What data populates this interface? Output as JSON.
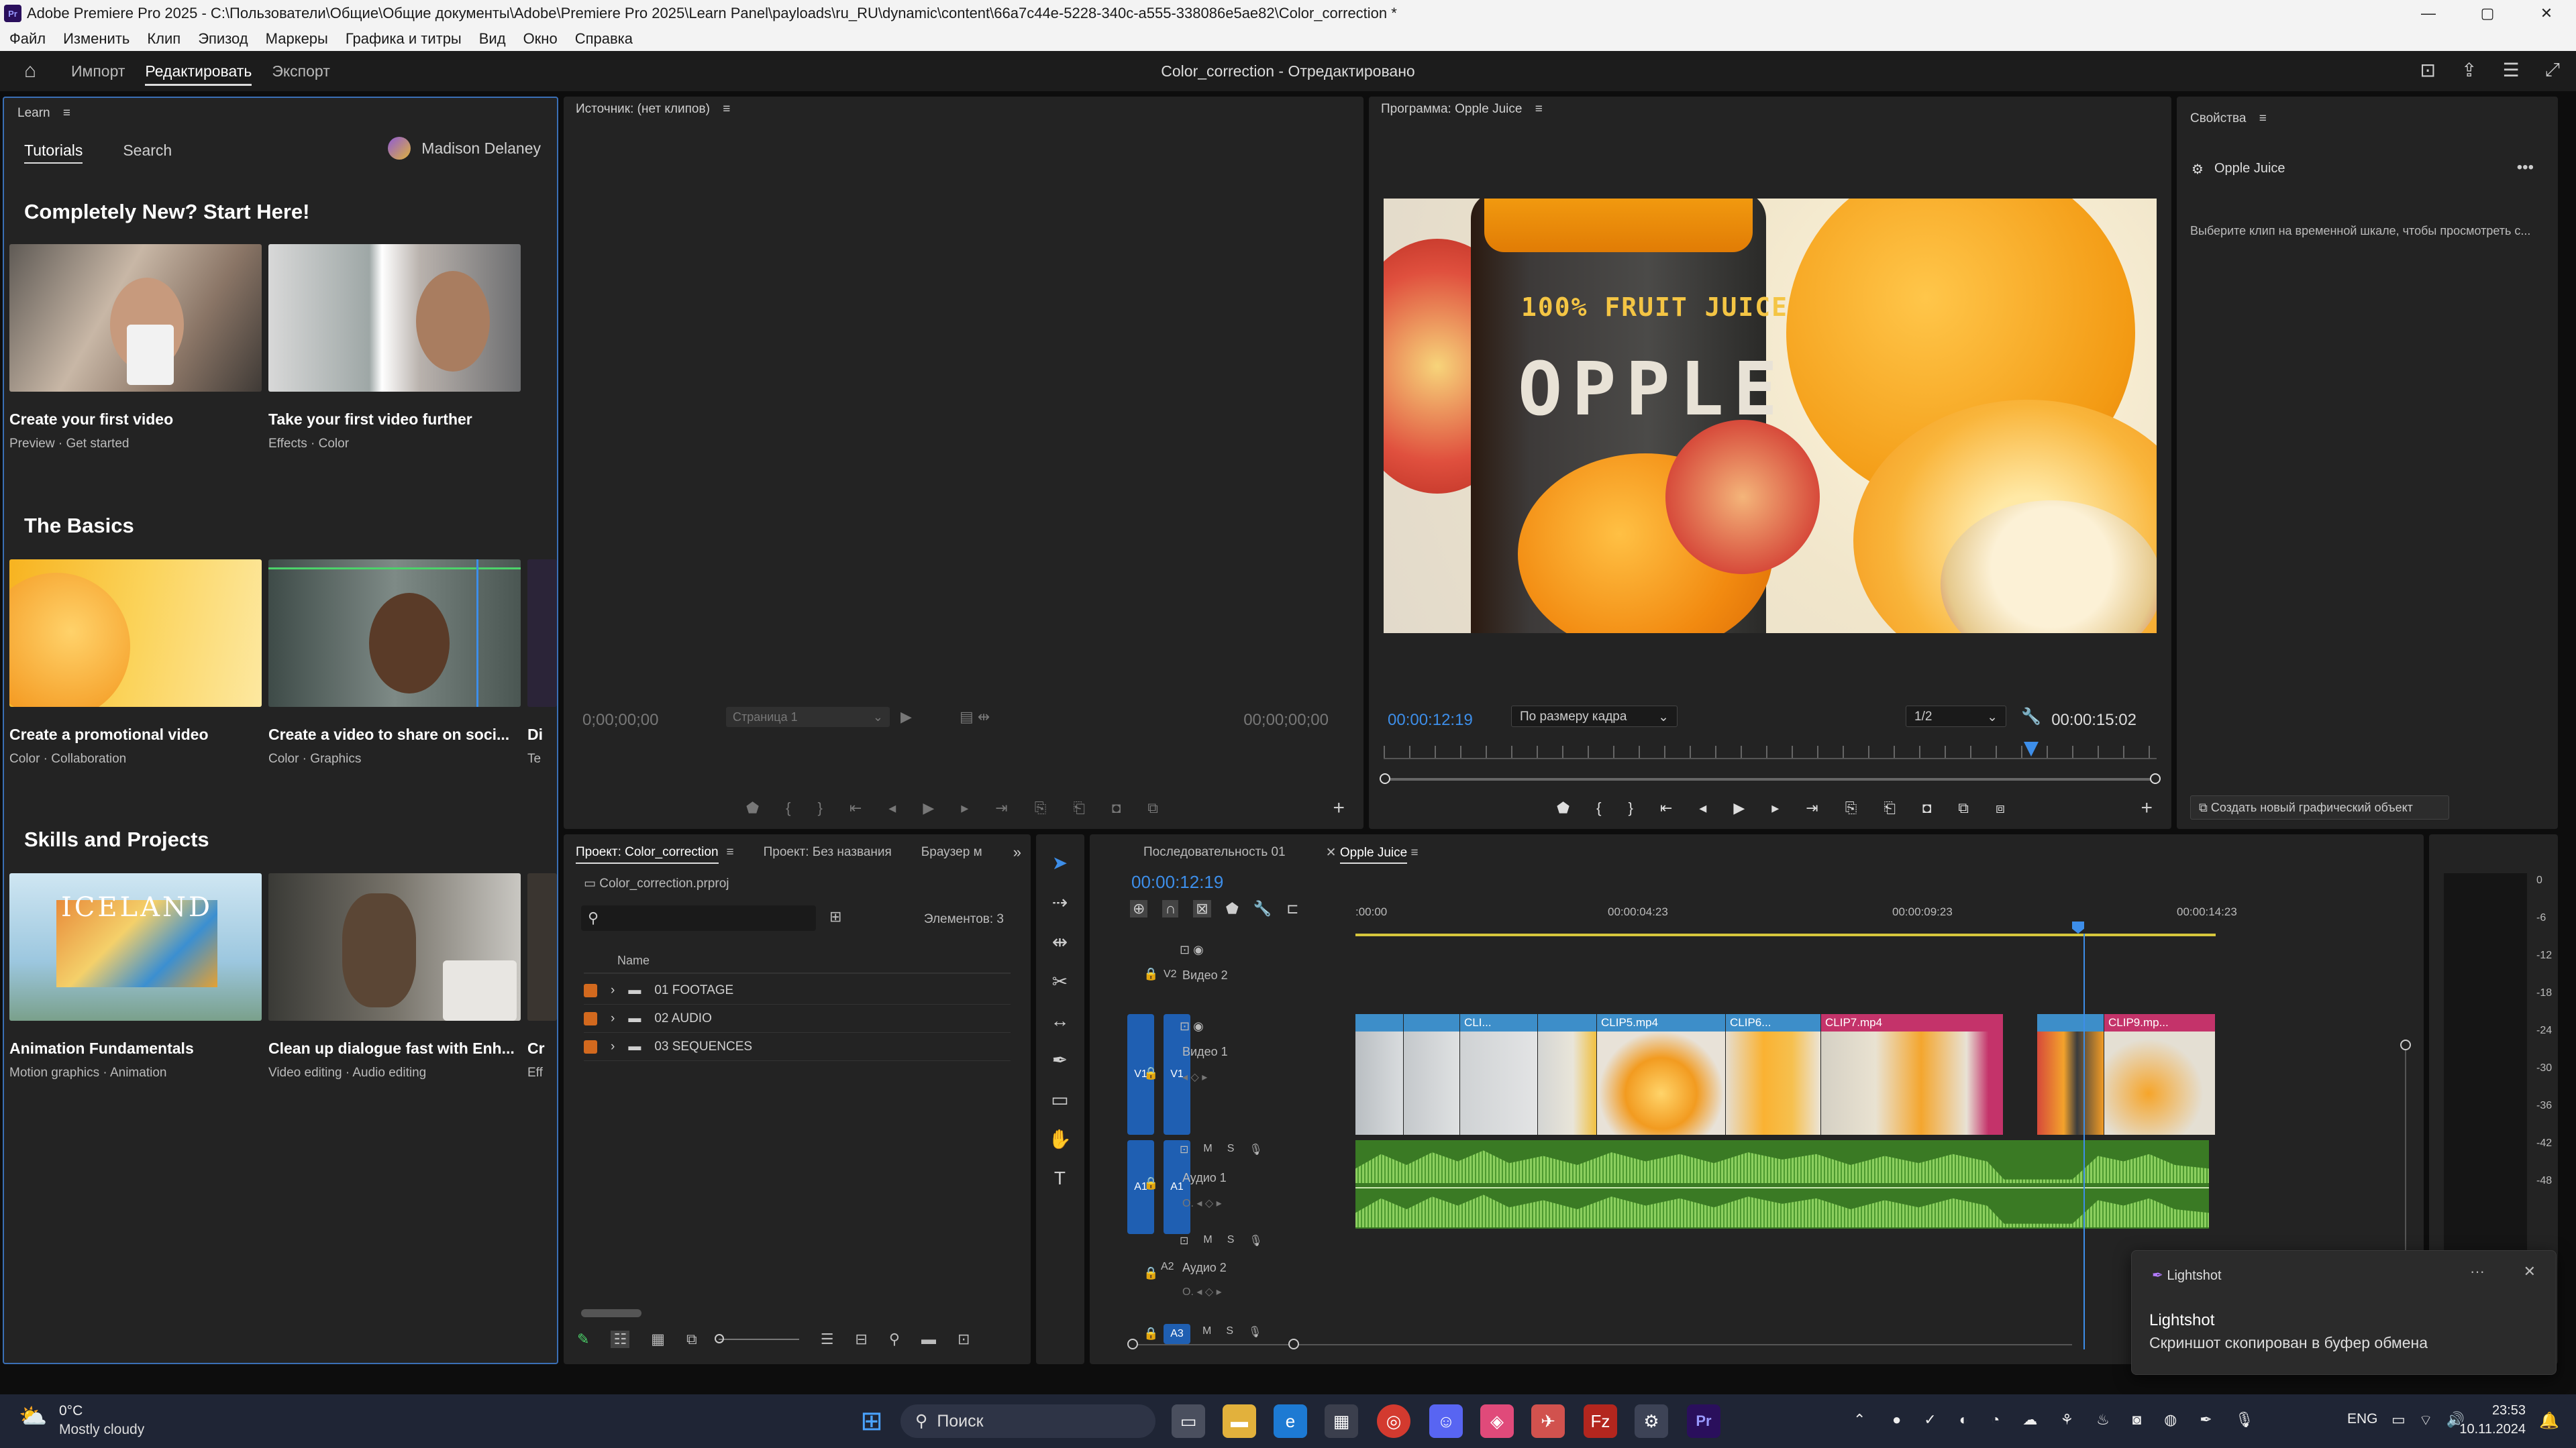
{
  "window": {
    "title": "Adobe Premiere Pro 2025 - C:\\Пользователи\\Общие\\Общие документы\\Adobe\\Premiere Pro 2025\\Learn Panel\\payloads\\ru_RU\\dynamic\\content\\66a7c44e-5228-340c-a555-338086e5ae82\\Color_correction *",
    "logo": "Pr",
    "minimize": "—",
    "maximize": "▢",
    "close": "✕"
  },
  "menu": [
    "Файл",
    "Изменить",
    "Клип",
    "Эпизод",
    "Маркеры",
    "Графика и титры",
    "Вид",
    "Окно",
    "Справка"
  ],
  "header": {
    "home_icon": "⌂",
    "tabs": [
      "Импорт",
      "Редактировать",
      "Экспорт"
    ],
    "doc_title": "Color_correction - Отредактировано"
  },
  "learn": {
    "title": "Learn",
    "tabs": [
      "Tutorials",
      "Search"
    ],
    "user": "Madison Delaney",
    "sections": [
      {
        "title": "Completely New? Start Here!",
        "cards": [
          {
            "title": "Create your first video",
            "sub": "Preview  ·  Get started"
          },
          {
            "title": "Take your first video further",
            "sub": "Effects  ·  Color"
          }
        ]
      },
      {
        "title": "The Basics",
        "cards": [
          {
            "title": "Create a promotional video",
            "sub": "Color  ·  Collaboration"
          },
          {
            "title": "Create a video to share on soci...",
            "sub": "Color  ·  Graphics"
          },
          {
            "title": "Di",
            "sub": "Te"
          }
        ]
      },
      {
        "title": "Skills and Projects",
        "cards": [
          {
            "title": "Animation Fundamentals",
            "sub": "Motion graphics  ·  Animation"
          },
          {
            "title": "Clean up dialogue fast with Enh...",
            "sub": "Video editing  ·  Audio editing"
          },
          {
            "title": "Cr",
            "sub": "Eff"
          }
        ]
      }
    ],
    "iceland": "ICELAND"
  },
  "source": {
    "title": "Источник: (нет клипов)",
    "tc_in": "0;00;00;00",
    "tc_out": "00;00;00;00",
    "page": "Страница 1"
  },
  "program": {
    "title": "Программа: Opple Juice",
    "timecode": "00:00:12:19",
    "fit": "По размеру кадра",
    "res": "1/2",
    "duration": "00:00:15:02",
    "label1": "100% FRUIT JUICE",
    "label2": "OPPLE"
  },
  "properties": {
    "title": "Свойства",
    "item": "Opple Juice",
    "hint": "Выберите клип на временной шкале, чтобы просмотреть с...",
    "button": "Создать новый графический объект"
  },
  "project": {
    "tabs": [
      "Проект: Color_correction",
      "Проект: Без названия",
      "Браузер м"
    ],
    "file": "Color_correction.prproj",
    "count": "Элементов: 3",
    "col_name": "Name",
    "items": [
      "01 FOOTAGE",
      "02 AUDIO",
      "03 SEQUENCES"
    ]
  },
  "timeline": {
    "tabs": [
      "Последовательность 01",
      "Opple Juice"
    ],
    "timecode": "00:00:12:19",
    "ruler": [
      ":00:00",
      "00:00:04:23",
      "00:00:09:23",
      "00:00:14:23"
    ],
    "tracks": {
      "v2": "V2",
      "v2name": "Видео 2",
      "v1": "V1",
      "v1name": "Видео 1",
      "a1": "A1",
      "a1name": "Аудио 1",
      "a2": "A2",
      "a2name": "Аудио 2",
      "a3": "A3"
    },
    "clips": [
      "",
      "",
      "CLI...",
      "",
      "CLIP5.mp4",
      "CLIP6...",
      "CLIP7.mp4",
      "",
      "CLIP9.mp..."
    ]
  },
  "meter": [
    "0",
    "-6",
    "-12",
    "-18",
    "-24",
    "-30",
    "-36",
    "-42",
    "-48"
  ],
  "notification": {
    "app": "Lightshot",
    "title": "Lightshot",
    "message": "Скриншот скопирован в буфер обмена"
  },
  "taskbar": {
    "temp": "0°C",
    "weather": "Mostly cloudy",
    "search": "Поиск",
    "lang": "ENG",
    "time": "23:53",
    "date": "10.11.2024"
  },
  "colors": {
    "accent": "#2d8ceb",
    "clip_blue": "#3d8ec9",
    "clip_pink": "#c4336a",
    "audio_green": "#3a7a24",
    "playhead": "#3d8ee9"
  }
}
